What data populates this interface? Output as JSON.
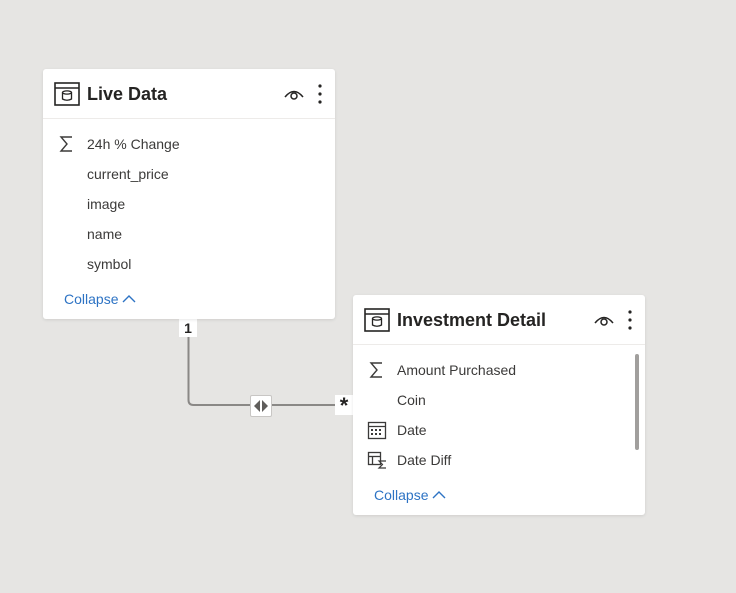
{
  "live_data": {
    "title": "Live Data",
    "fields": [
      {
        "label": "24h % Change",
        "icon": "sigma-icon"
      },
      {
        "label": "current_price",
        "icon": ""
      },
      {
        "label": "image",
        "icon": ""
      },
      {
        "label": "name",
        "icon": ""
      },
      {
        "label": "symbol",
        "icon": ""
      }
    ],
    "collapse_label": "Collapse"
  },
  "investment_detail": {
    "title": "Investment Detail",
    "fields": [
      {
        "label": "Amount Purchased",
        "icon": "sigma-icon"
      },
      {
        "label": "Coin",
        "icon": ""
      },
      {
        "label": "Date",
        "icon": "calendar-icon"
      },
      {
        "label": "Date Diff",
        "icon": "calculated-column-icon"
      }
    ],
    "collapse_label": "Collapse"
  },
  "relationship": {
    "from_cardinality": "1",
    "to_cardinality": "*",
    "cross_filter": "both",
    "line_color": "#8a8886"
  },
  "colors": {
    "canvas": "#e6e5e3",
    "card": "#ffffff",
    "link": "#2d73c4"
  }
}
